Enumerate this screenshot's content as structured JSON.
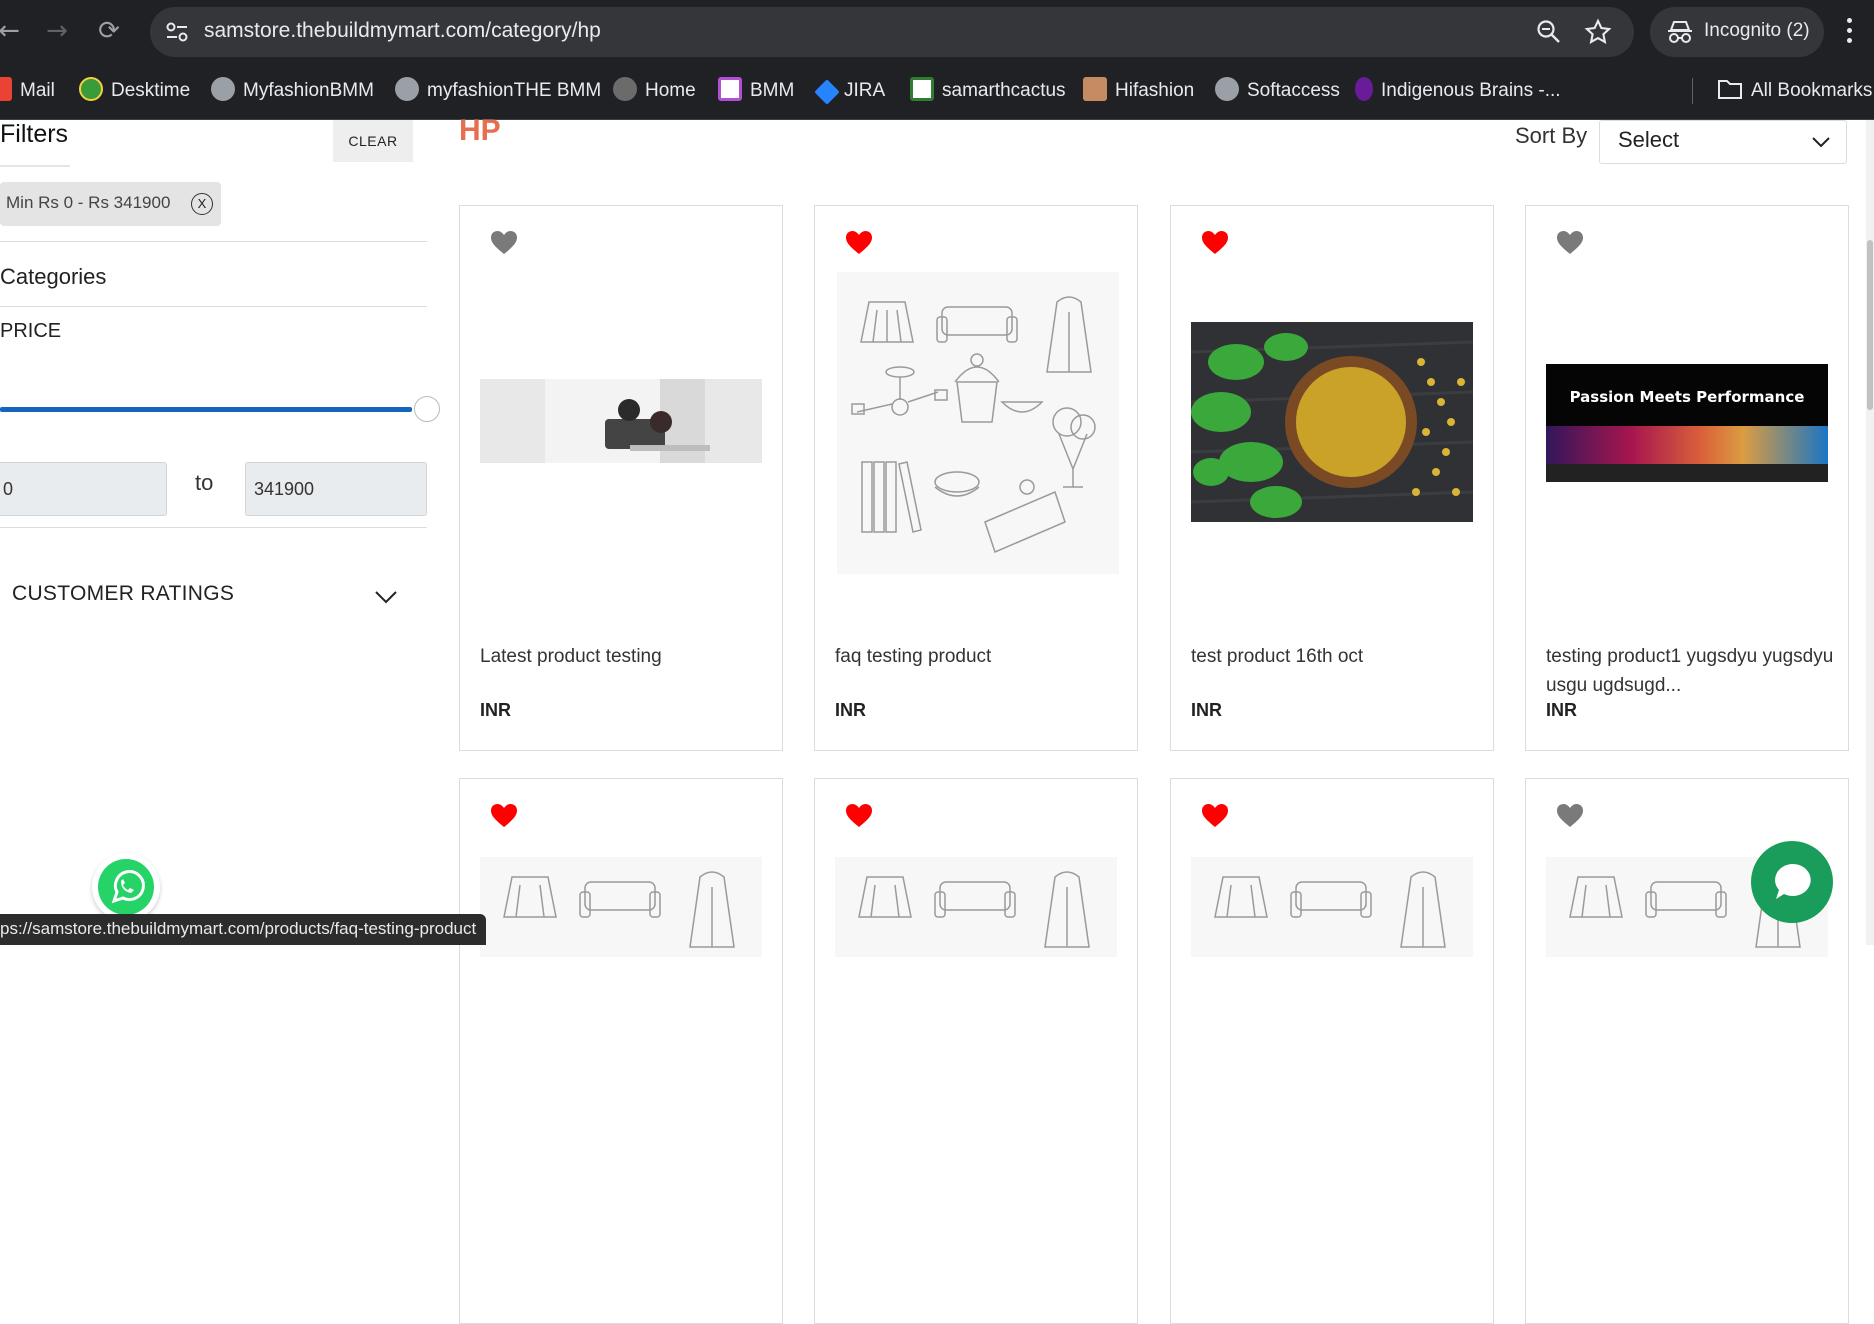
{
  "browser": {
    "url": "samstore.thebuildmymart.com/category/hp",
    "incognito_label": "Incognito (2)",
    "bookmarks": [
      {
        "label": "Mail",
        "color": "#ea4335"
      },
      {
        "label": "Desktime",
        "color": "#3a9b3a"
      },
      {
        "label": "MyfashionBMM",
        "color": "#9aa0a6"
      },
      {
        "label": "myfashionTHE BMM",
        "color": "#9aa0a6"
      },
      {
        "label": "Home",
        "color": "#6b6b6b"
      },
      {
        "label": "BMM",
        "color": "#b34fd6"
      },
      {
        "label": "JIRA",
        "color": "#2684ff"
      },
      {
        "label": "samarthcactus",
        "color": "#2e7d32"
      },
      {
        "label": "Hifashion",
        "color": "#c78b63"
      },
      {
        "label": "Softaccess",
        "color": "#9aa0a6"
      },
      {
        "label": "Indigenous Brains -...",
        "color": "#6a1b9a"
      }
    ],
    "all_bookmarks": "All Bookmarks"
  },
  "sidebar": {
    "title": "Filters",
    "clear_label": "CLEAR",
    "chip_label": "Min Rs 0 - Rs 341900",
    "chip_remove": "X",
    "categories_label": "Categories",
    "price_label": "PRICE",
    "price_min": "0",
    "price_to": "to",
    "price_max": "341900",
    "slider_level": 1.0,
    "customer_ratings_label": "CUSTOMER RATINGS"
  },
  "main": {
    "title": "HP",
    "sort_by_label": "Sort By",
    "sort_selected": "Select",
    "products": [
      {
        "name": "Latest product testing",
        "price": "INR",
        "wishlisted": false
      },
      {
        "name": "faq testing product",
        "price": "INR",
        "wishlisted": true
      },
      {
        "name": "test product 16th oct",
        "price": "INR",
        "wishlisted": true
      },
      {
        "name": "testing product1 yugsdyu yugsdyu usgu ugdsugd...",
        "price": "INR",
        "wishlisted": false,
        "image_text": "Passion Meets Performance"
      },
      {
        "wishlisted": true
      },
      {
        "wishlisted": true
      },
      {
        "wishlisted": true
      },
      {
        "wishlisted": false
      }
    ]
  },
  "status_bar": "ps://samstore.thebuildmymart.com/products/faq-testing-product",
  "colors": {
    "accent": "#e76f51",
    "slider": "#1565c0",
    "heart_on": "#ff0000",
    "heart_off": "#7a7a7a",
    "chat": "#1a9c5b"
  }
}
